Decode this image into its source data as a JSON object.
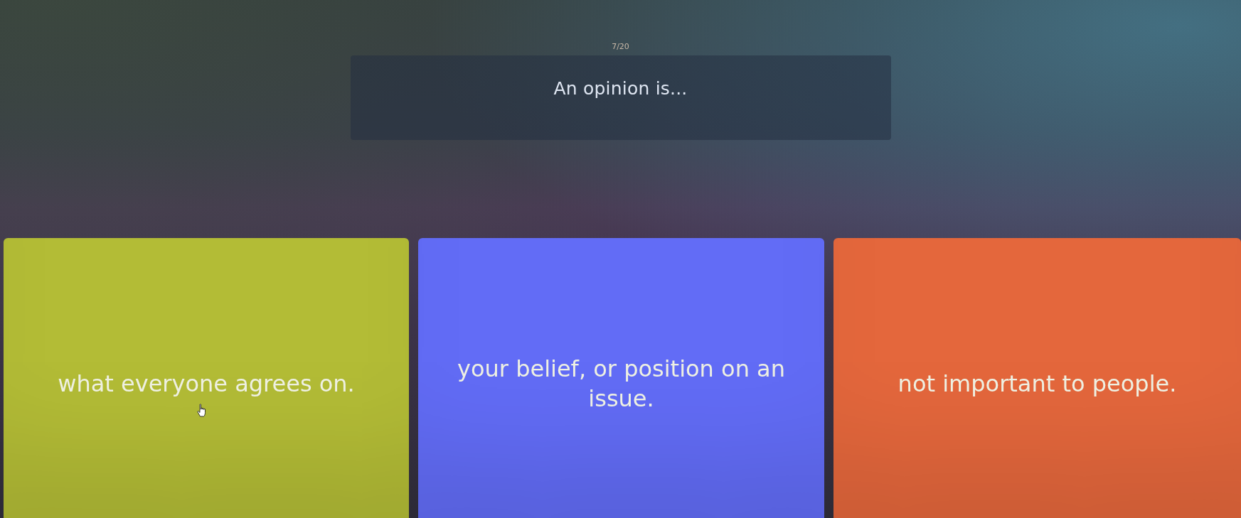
{
  "progress": "7/20",
  "question": "An opinion is...",
  "answers": [
    {
      "text": "what everyone agrees on.",
      "color": "#b3bc36"
    },
    {
      "text": "your belief, or position on an issue.",
      "color": "#626cf6"
    },
    {
      "text": "not important to people.",
      "color": "#e4673c"
    }
  ]
}
